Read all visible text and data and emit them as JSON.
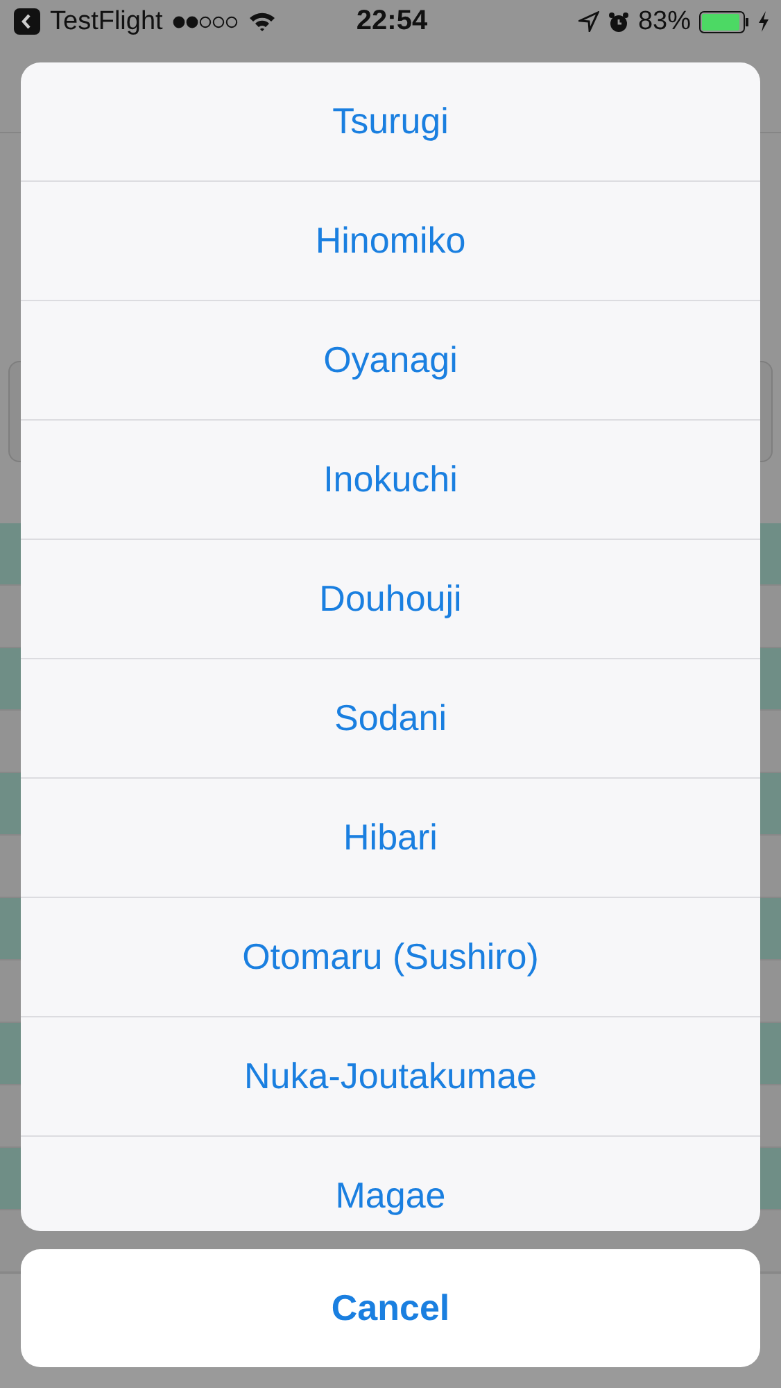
{
  "status_bar": {
    "back_app": "TestFlight",
    "time": "22:54",
    "battery": "83%"
  },
  "action_sheet": {
    "options": [
      "Tsurugi",
      "Hinomiko",
      "Oyanagi",
      "Inokuchi",
      "Douhouji",
      "Sodani",
      "Hibari",
      "Otomaru (Sushiro)",
      "Nuka-Joutakumae",
      "Magae"
    ],
    "cancel": "Cancel"
  }
}
